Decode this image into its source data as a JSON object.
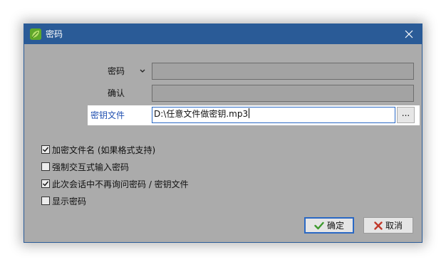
{
  "window": {
    "title": "密码",
    "close_symbol": "✕"
  },
  "fields": {
    "password_label": "密码",
    "confirm_label": "确认",
    "password_value": "",
    "confirm_value": ""
  },
  "keyfile": {
    "label": "密钥文件",
    "value": "D:\\任意文件做密钥.mp3",
    "browse_label": "..."
  },
  "options": [
    {
      "label": "加密文件名 (如果格式支持)",
      "checked": true
    },
    {
      "label": "强制交互式输入密码",
      "checked": false
    },
    {
      "label": "此次会话中不再询问密码 / 密钥文件",
      "checked": true
    },
    {
      "label": "显示密码",
      "checked": false
    }
  ],
  "buttons": {
    "ok_label": "确定",
    "cancel_label": "取消"
  },
  "colors": {
    "titlebar": "#2a5b97",
    "dialog_bg": "#ababab",
    "keyfile_label": "#1f4fb0",
    "ok_icon": "#3e9a2e",
    "cancel_icon": "#c0392b"
  },
  "icons": {
    "app": "green-leaf-icon",
    "close": "close-icon",
    "dropdown": "chevron-down-icon",
    "ok": "check-icon",
    "cancel": "x-icon"
  }
}
